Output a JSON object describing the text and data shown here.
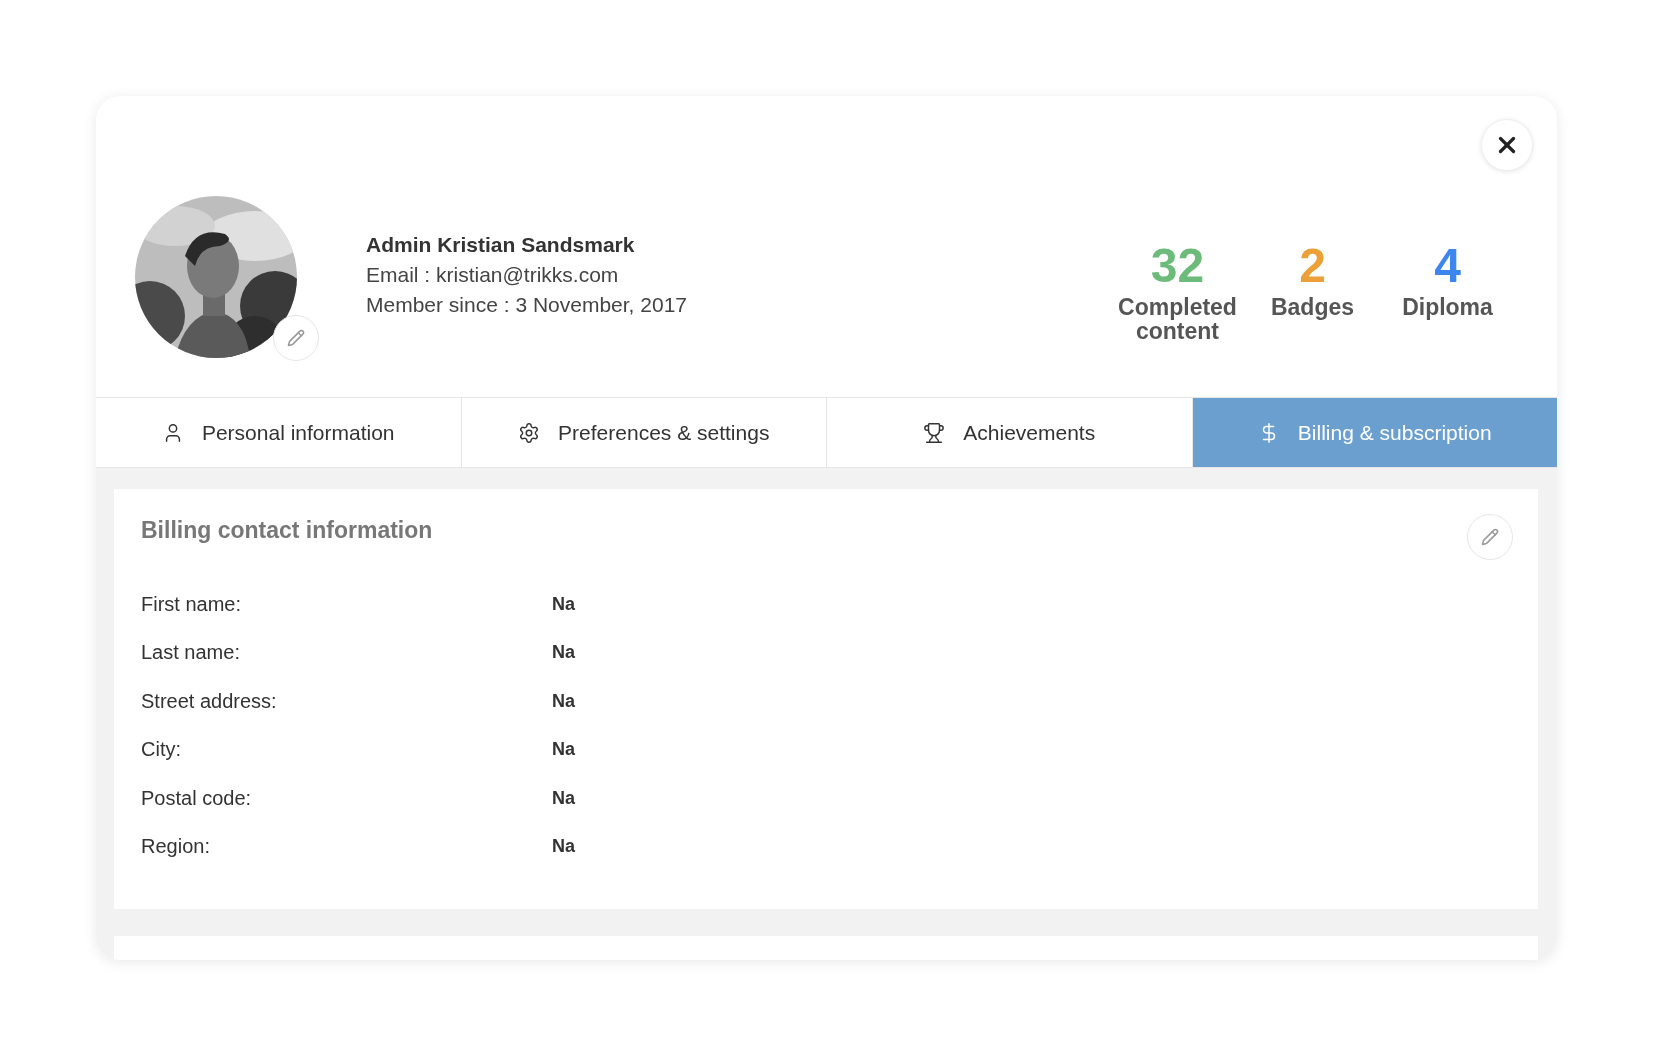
{
  "profile": {
    "name": "Admin Kristian Sandsmark",
    "email": "Email : kristian@trikks.com",
    "member_since": "Member since : 3 November, 2017"
  },
  "stats": [
    {
      "value": "32",
      "label": "Completed content",
      "color": "#6dbb7a"
    },
    {
      "value": "2",
      "label": "Badges",
      "color": "#eba038"
    },
    {
      "value": "4",
      "label": "Diploma",
      "color": "#3d86f0"
    }
  ],
  "tabs": [
    {
      "label": "Personal information",
      "kind": "person",
      "selected": false
    },
    {
      "label": "Preferences & settings",
      "kind": "gear",
      "selected": false
    },
    {
      "label": "Achievements",
      "kind": "trophy",
      "selected": false
    },
    {
      "label": "Billing & subscription",
      "kind": "dollar",
      "selected": true
    }
  ],
  "billing": {
    "title": "Billing contact information",
    "fields": [
      {
        "label": "First name:",
        "value": "Na"
      },
      {
        "label": "Last name:",
        "value": "Na"
      },
      {
        "label": "Street address:",
        "value": "Na"
      },
      {
        "label": "City:",
        "value": "Na"
      },
      {
        "label": "Postal code:",
        "value": "Na"
      },
      {
        "label": "Region:",
        "value": "Na"
      }
    ]
  }
}
